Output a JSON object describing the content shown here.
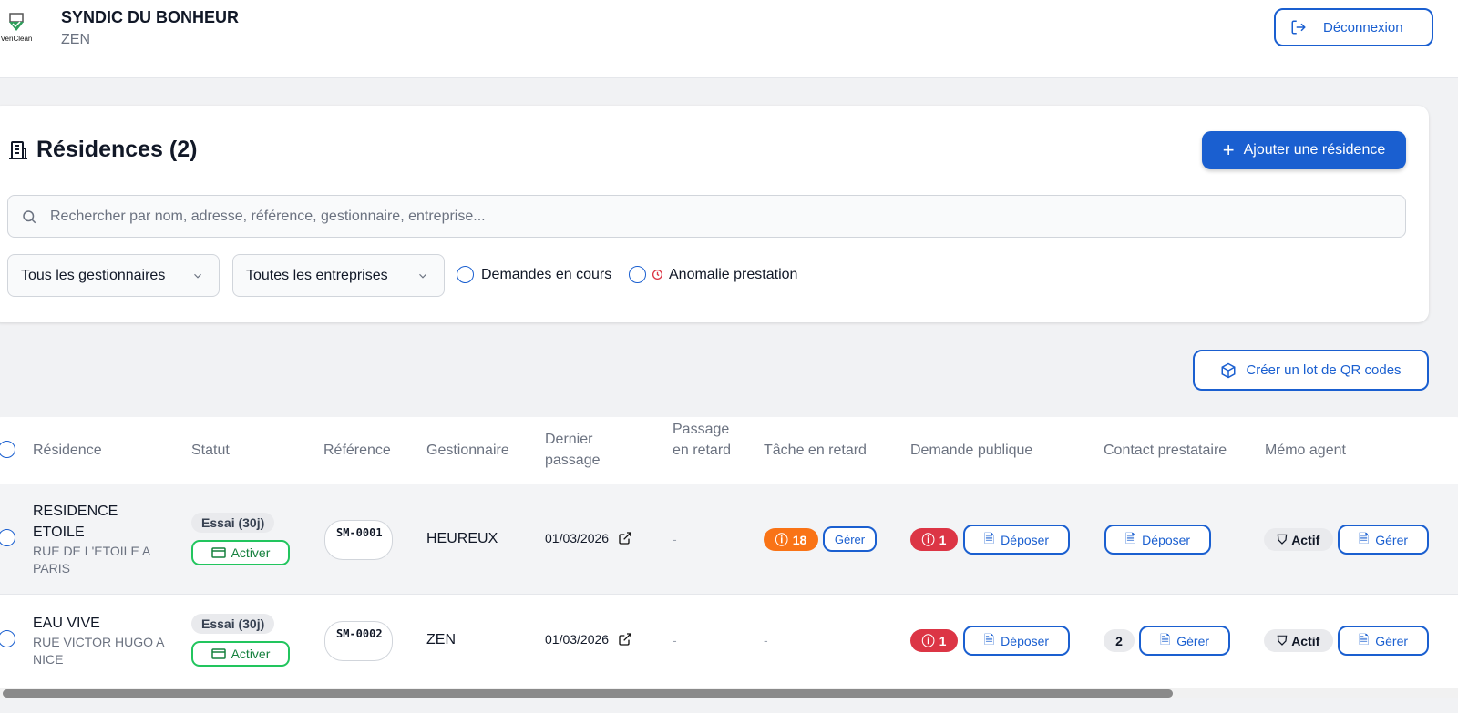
{
  "header": {
    "logo_text": "VeriClean",
    "org_name": "SYNDIC DU BONHEUR",
    "sub_name": "ZEN",
    "logout_label": "Déconnexion"
  },
  "page": {
    "title": "Résidences (2)",
    "add_label": "Ajouter une résidence",
    "search_placeholder": "Rechercher par nom, adresse, référence, gestionnaire, entreprise...",
    "filter_manager": "Tous les gestionnaires",
    "filter_company": "Toutes les entreprises",
    "check_requests": "Demandes en cours",
    "check_anomaly": "Anomalie prestation",
    "qr_label": "Créer un lot de QR codes"
  },
  "table": {
    "headers": [
      "Résidence",
      "Statut",
      "Référence",
      "Gestionnaire",
      "Dernier passage",
      "Passage en retard",
      "Tâche en retard",
      "Demande publique",
      "Contact prestataire",
      "Mémo agent"
    ],
    "rows": [
      {
        "name": "RESIDENCE ETOILE",
        "address": "RUE DE L'ETOILE A PARIS",
        "status": "Essai (30j)",
        "activate": "Activer",
        "ref": "SM-0001",
        "manager": "HEUREUX",
        "last_visit": "01/03/2026",
        "late_visit": "-",
        "late_task": "18",
        "late_task_action": "Gérer",
        "public_request": "1",
        "public_action": "Déposer",
        "contact_count": "",
        "contact_action": "Déposer",
        "memo_status": "Actif",
        "memo_action": "Gérer"
      },
      {
        "name": "EAU VIVE",
        "address": "RUE VICTOR HUGO A NICE",
        "status": "Essai (30j)",
        "activate": "Activer",
        "ref": "SM-0002",
        "manager": "ZEN",
        "last_visit": "01/03/2026",
        "late_visit": "-",
        "late_task": "-",
        "late_task_action": "",
        "public_request": "1",
        "public_action": "Déposer",
        "contact_count": "2",
        "contact_action": "Gérer",
        "memo_status": "Actif",
        "memo_action": "Gérer"
      }
    ]
  },
  "colors": {
    "primary": "#1a5fd0",
    "warning": "#f97316",
    "danger": "#dc3545",
    "success": "#22c55e"
  }
}
